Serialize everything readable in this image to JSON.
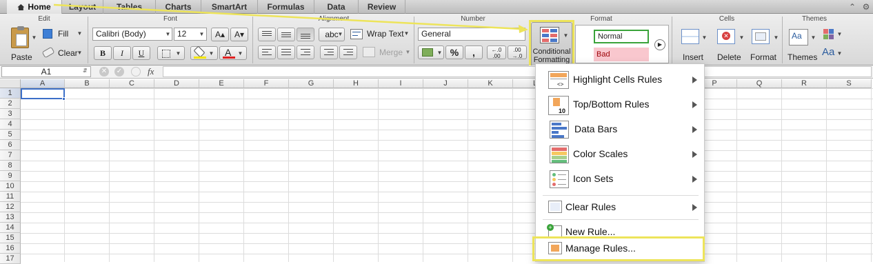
{
  "tabs": [
    {
      "label": "Home",
      "active": true
    },
    {
      "label": "Layout"
    },
    {
      "label": "Tables"
    },
    {
      "label": "Charts"
    },
    {
      "label": "SmartArt"
    },
    {
      "label": "Formulas"
    },
    {
      "label": "Data"
    },
    {
      "label": "Review"
    }
  ],
  "ribbon": {
    "groups": {
      "edit": "Edit",
      "font": "Font",
      "alignment": "Alignment",
      "number": "Number",
      "format": "Format",
      "cells": "Cells",
      "themes": "Themes"
    },
    "paste": "Paste",
    "fill": "Fill",
    "clear": "Clear",
    "font_name": "Calibri (Body)",
    "font_size": "12",
    "bold": "B",
    "italic": "I",
    "underline": "U",
    "font_color_letter": "A",
    "grow_font": "A▴",
    "shrink_font": "A▾",
    "text_orient": "abc",
    "wrap_text": "Wrap Text",
    "merge": "Merge",
    "number_format": "General",
    "percent": "%",
    "comma": ",",
    "dec_inc": "←.0 .00",
    "dec_dec": ".00 →.0",
    "conditional_formatting_line1": "Conditional",
    "conditional_formatting_line2": "Formatting",
    "style_normal": "Normal",
    "style_bad": "Bad",
    "insert": "Insert",
    "delete": "Delete",
    "format": "Format",
    "themes": "Themes",
    "theme_fonts": "Aa",
    "theme_sample": "Aa"
  },
  "formula_bar": {
    "name_box": "A1",
    "fx": "fx",
    "cancel": "✕",
    "enter": "✓"
  },
  "grid": {
    "columns": [
      "A",
      "B",
      "C",
      "D",
      "E",
      "F",
      "G",
      "H",
      "I",
      "J",
      "K",
      "L",
      "M",
      "N",
      "O",
      "P",
      "Q",
      "R",
      "S"
    ],
    "rows": [
      "1",
      "2",
      "3",
      "4",
      "5",
      "6",
      "7",
      "8",
      "9",
      "10",
      "11",
      "12",
      "13",
      "14",
      "15",
      "16",
      "17"
    ],
    "selected_cell": "A1"
  },
  "menu": {
    "highlight_cells_rules": "Highlight Cells Rules",
    "top_bottom_rules": "Top/Bottom Rules",
    "data_bars": "Data Bars",
    "color_scales": "Color Scales",
    "icon_sets": "Icon Sets",
    "clear_rules": "Clear Rules",
    "new_rule": "New Rule...",
    "manage_rules": "Manage Rules..."
  },
  "colors": {
    "highlight": "#ede45a",
    "selection": "#3c6fc8",
    "style_normal_border": "#3aa33a",
    "style_bad_bg": "#f9c7ce",
    "font_color_bar": "#e02020",
    "fill_color_bar": "#f3e600"
  },
  "icons": [
    "home-icon",
    "paste-icon",
    "fill-icon",
    "eraser-icon",
    "borders-icon",
    "fill-color-icon",
    "wrap-text-icon",
    "merge-icon",
    "currency-icon",
    "conditional-formatting-icon",
    "insert-cells-icon",
    "delete-cells-icon",
    "format-cells-icon",
    "themes-icon",
    "theme-colors-icon",
    "collapse-ribbon-icon",
    "help-icon"
  ]
}
